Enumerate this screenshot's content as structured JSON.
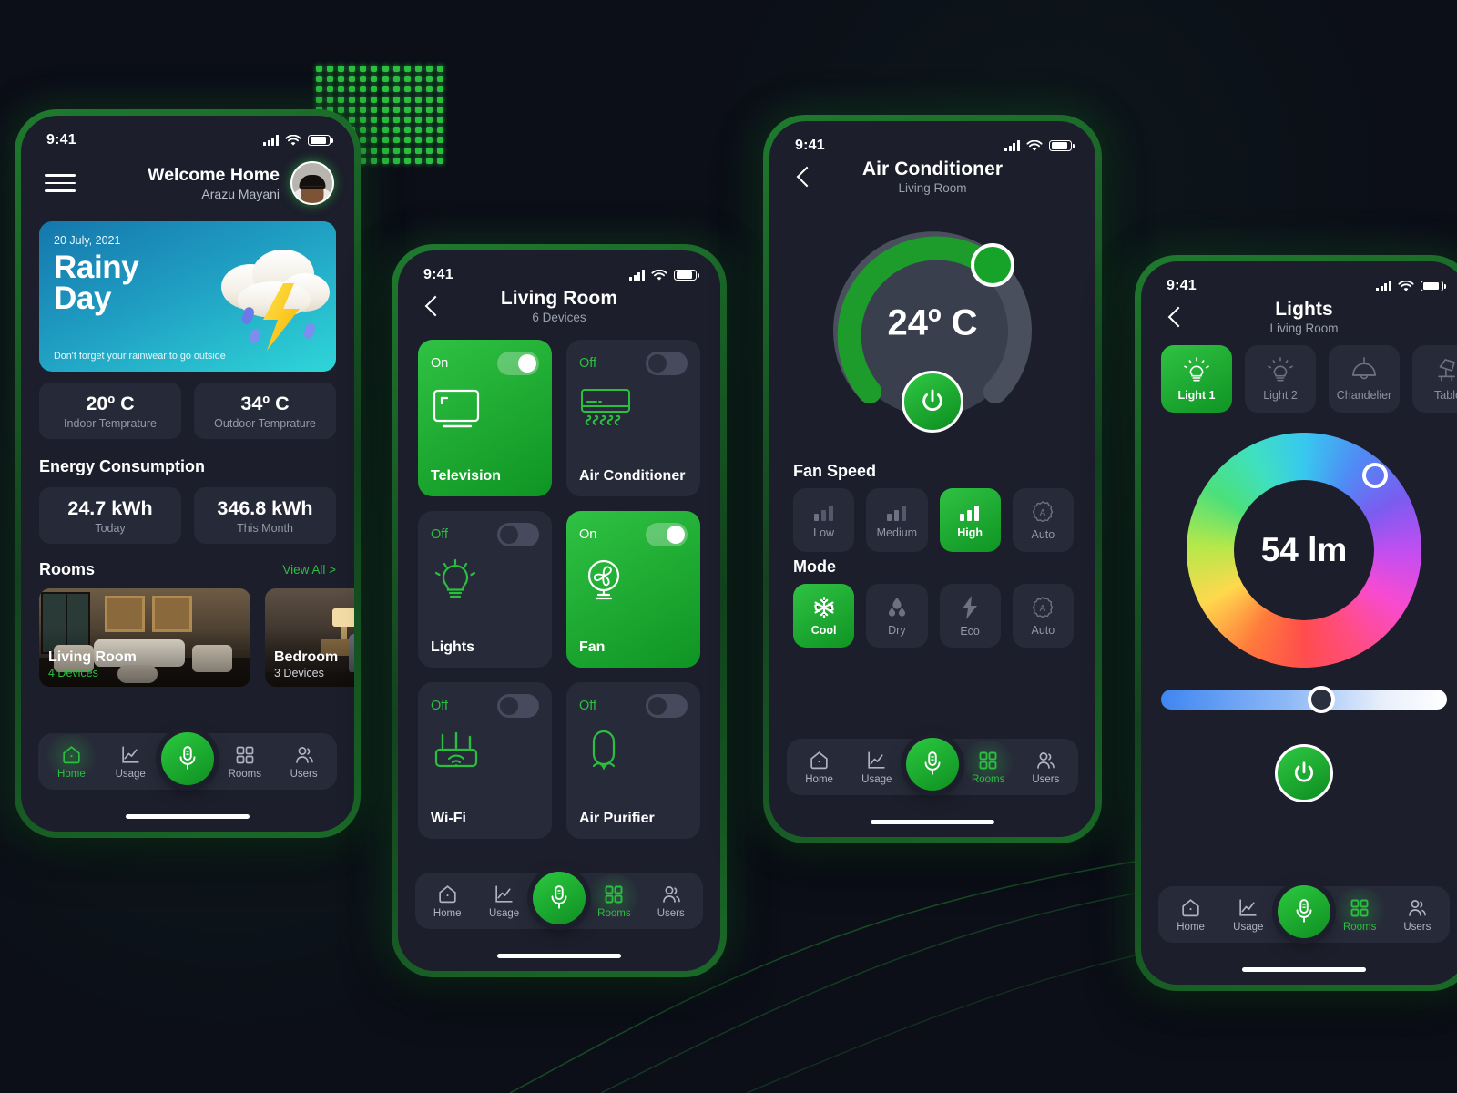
{
  "statusbar": {
    "time": "9:41"
  },
  "home": {
    "greeting": "Welcome Home",
    "user": "Arazu Mayani",
    "weather": {
      "date": "20 July, 2021",
      "title_line1": "Rainy",
      "title_line2": "Day",
      "subtitle": "Don't forget your rainwear to go outside"
    },
    "temps": [
      {
        "value": "20º C",
        "label": "Indoor Temprature"
      },
      {
        "value": "34º C",
        "label": "Outdoor Temprature"
      }
    ],
    "energy_title": "Energy Consumption",
    "energy": [
      {
        "value": "24.7 kWh",
        "label": "Today"
      },
      {
        "value": "346.8 kWh",
        "label": "This Month"
      }
    ],
    "rooms_title": "Rooms",
    "view_all": "View All >",
    "rooms": [
      {
        "name": "Living Room",
        "devices": "4 Devices"
      },
      {
        "name": "Bedroom",
        "devices": "3 Devices"
      }
    ]
  },
  "room": {
    "title": "Living Room",
    "subtitle": "6 Devices",
    "devices": [
      {
        "state": "On",
        "name": "Television",
        "icon": "television-icon",
        "on": true
      },
      {
        "state": "Off",
        "name": "Air Conditioner",
        "icon": "air-conditioner-icon",
        "on": false
      },
      {
        "state": "Off",
        "name": "Lights",
        "icon": "bulb-icon",
        "on": false
      },
      {
        "state": "On",
        "name": "Fan",
        "icon": "fan-icon",
        "on": true
      },
      {
        "state": "Off",
        "name": "Wi-Fi",
        "icon": "router-icon",
        "on": false
      },
      {
        "state": "Off",
        "name": "Air Purifier",
        "icon": "air-purifier-icon",
        "on": false
      }
    ]
  },
  "ac": {
    "title": "Air Conditioner",
    "subtitle": "Living Room",
    "temperature": "24º C",
    "fan_speed_title": "Fan Speed",
    "fan_speeds": [
      {
        "label": "Low",
        "icon": "bars-low-icon",
        "selected": false
      },
      {
        "label": "Medium",
        "icon": "bars-medium-icon",
        "selected": false
      },
      {
        "label": "High",
        "icon": "bars-high-icon",
        "selected": true
      },
      {
        "label": "Auto",
        "icon": "auto-badge-icon",
        "selected": false
      }
    ],
    "mode_title": "Mode",
    "modes": [
      {
        "label": "Cool",
        "icon": "snowflake-icon",
        "selected": true
      },
      {
        "label": "Dry",
        "icon": "droplets-icon",
        "selected": false
      },
      {
        "label": "Eco",
        "icon": "bolt-icon",
        "selected": false
      },
      {
        "label": "Auto",
        "icon": "auto-badge-icon",
        "selected": false
      }
    ]
  },
  "lights": {
    "title": "Lights",
    "subtitle": "Living Room",
    "fixtures": [
      {
        "label": "Light 1",
        "icon": "bulb-icon",
        "selected": true
      },
      {
        "label": "Light 2",
        "icon": "bulb-icon",
        "selected": false
      },
      {
        "label": "Chandelier",
        "icon": "chandelier-icon",
        "selected": false
      },
      {
        "label": "Table",
        "icon": "table-lamp-icon",
        "selected": false
      }
    ],
    "lumens": "54 lm"
  },
  "nav": {
    "items": [
      {
        "label": "Home",
        "icon": "home-icon"
      },
      {
        "label": "Usage",
        "icon": "chart-icon"
      },
      {
        "label": "Rooms",
        "icon": "grid-icon"
      },
      {
        "label": "Users",
        "icon": "users-icon"
      }
    ],
    "mic": "mic-icon"
  },
  "colors": {
    "accent": "#2bbf3f",
    "background": "#0c0e18",
    "screen": "#1c1e2b",
    "card": "#272b39",
    "muted_text": "#9298a6"
  }
}
